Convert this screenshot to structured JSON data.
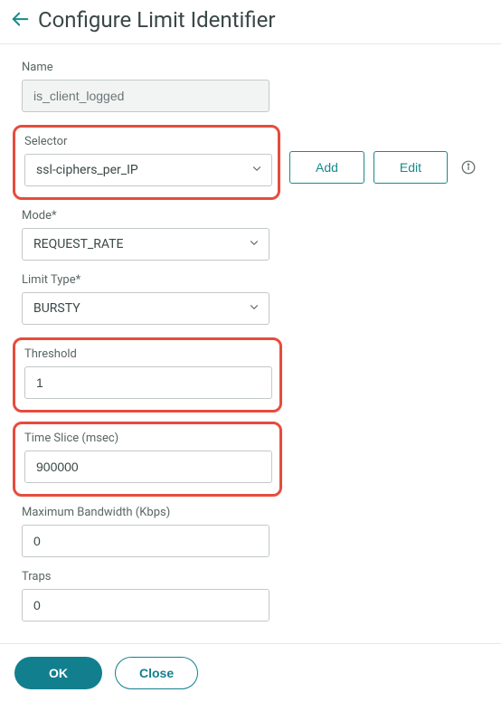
{
  "header": {
    "title": "Configure Limit Identifier"
  },
  "fields": {
    "name": {
      "label": "Name",
      "value": "is_client_logged"
    },
    "selector": {
      "label": "Selector",
      "value": "ssl-ciphers_per_IP",
      "add_label": "Add",
      "edit_label": "Edit"
    },
    "mode": {
      "label": "Mode*",
      "value": "REQUEST_RATE"
    },
    "limit_type": {
      "label": "Limit Type*",
      "value": "BURSTY"
    },
    "threshold": {
      "label": "Threshold",
      "value": "1"
    },
    "time_slice": {
      "label": "Time Slice (msec)",
      "value": "900000"
    },
    "max_bandwidth": {
      "label": "Maximum Bandwidth (Kbps)",
      "value": "0"
    },
    "traps": {
      "label": "Traps",
      "value": "0"
    }
  },
  "footer": {
    "ok_label": "OK",
    "close_label": "Close"
  }
}
